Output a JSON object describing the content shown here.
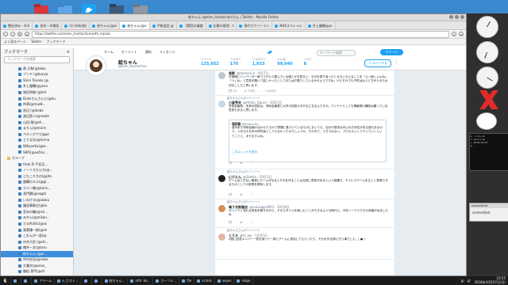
{
  "desktop": {
    "icons": [
      "folder-red-icon",
      "folder-blue-icon",
      "twitter-icon",
      "folder-dark-icon",
      "folder-gray-icon"
    ]
  },
  "browser": {
    "title": "絵ちゃん (@eien_hantachan)さん | Twitter - Mozilla Firefox",
    "tabs": [
      "整形済み - 4ch",
      "合同・市場見",
      "(1) 所有(絵)",
      "絵ちゃん(@ei",
      "絵ちゃん(@e",
      "手帳会話 @",
      "【関西の議論",
      "記事の管理 - t",
      "現代ホワイトラン",
      "NHKスペシャル",
      "井上優輔@yo"
    ],
    "active_tab_index": 4,
    "url": "https://twitter.com/eien_hantachan/with_replies",
    "bookmarks_bar": [
      "よく見るページ",
      "Twitter",
      "ブックマーク"
    ]
  },
  "sidebar": {
    "title": "ブックマーク",
    "search_placeholder": "ブックマークを検索",
    "items": [
      {
        "label": "燕 大和(@kabu",
        "folder": false
      },
      {
        "label": "ブンヤ (@bunya",
        "folder": false
      },
      {
        "label": "Shiro Tanaka (@",
        "folder": false
      },
      {
        "label": "井上優輔(@yosu",
        "folder": false
      },
      {
        "label": "和田秀樹 (@hid",
        "folder": false
      },
      {
        "label": "Dukeさんさんと(@du",
        "folder": false
      },
      {
        "label": "仲原(@maz8...",
        "folder": false
      },
      {
        "label": "池辺 (@ikebe",
        "folder": false
      },
      {
        "label": "渡辺直人(@naoto",
        "folder": false
      },
      {
        "label": "山田 翔(@sh...",
        "folder": false
      },
      {
        "label": "まりん(@marin",
        "folder": false
      },
      {
        "label": "ペキングアカ@pe",
        "folder": false
      },
      {
        "label": "とりなお(@torina",
        "folder": false
      },
      {
        "label": "Wikipedia(@w...",
        "folder": false
      },
      {
        "label": "SW5(@sw5ns...",
        "folder": false
      },
      {
        "label": "グループ",
        "folder": true
      },
      {
        "label": "hhat 声 戸田玉...",
        "folder": false
      },
      {
        "label": "ノーミスたんち(@...",
        "folder": false
      },
      {
        "label": "じたこたちの(@jita",
        "folder": false
      },
      {
        "label": "銀翼のスエ(@gi...",
        "folder": false
      },
      {
        "label": "カリン集(@karin...",
        "folder": false
      },
      {
        "label": "長門勝(@nagat",
        "folder": false
      },
      {
        "label": "いわげる(@iwaku",
        "folder": false
      },
      {
        "label": "議会事務主(@ka",
        "folder": false
      },
      {
        "label": "宮永の輪(@ish...",
        "folder": false
      },
      {
        "label": "みかん(@mikan...",
        "folder": false
      },
      {
        "label": "ガスPolitic(@as",
        "folder": false
      },
      {
        "label": "真素爆一郎(@sh",
        "folder": false
      },
      {
        "label": "これんが一部(@",
        "folder": false
      },
      {
        "label": "市井大民 (@shi...",
        "folder": false
      },
      {
        "label": "樽井一文(@taru",
        "folder": false
      },
      {
        "label": "絵ちゃん (@ei...",
        "folder": false,
        "selected": true
      },
      {
        "label": "中村光弘(@naka",
        "folder": false
      },
      {
        "label": "大瀬文(@oose_",
        "folder": false
      },
      {
        "label": "蝶松 亮門(@ch",
        "folder": false
      },
      {
        "label": "井上 亮 (@inoue",
        "folder": false
      },
      {
        "label": "ポチ(@pochi_",
        "folder": false
      },
      {
        "label": "厦奈吉里(@karo",
        "folder": false
      },
      {
        "label": "阿佐谷(@asagaya",
        "folder": false
      }
    ]
  },
  "twitter": {
    "nav": [
      "ホーム",
      "モーメント",
      "通知",
      "メッセージ"
    ],
    "search_placeholder": "キーワード検索",
    "tweet_button": "ツイート",
    "profile": {
      "name": "絵ちゃん",
      "handle": "@eien_hantachan"
    },
    "stats": [
      {
        "label": "ツイート",
        "value": "125,652"
      },
      {
        "label": "フォロー",
        "value": "170"
      },
      {
        "label": "フォロワー",
        "value": "1,033"
      },
      {
        "label": "いいね",
        "value": "99,040"
      },
      {
        "label": "リスト",
        "value": "8"
      }
    ],
    "follow_button": "フォローする",
    "tweets": [
      {
        "context": "",
        "name": "長野",
        "handle": "@tomoso_h · 8月7日",
        "body": "お被様にハンバーガー食べさせたら喜んでいる顔とかを見ると、今日を振り返ったとるもいろんなことを「えっ新しいよね」「つくね」と意見を聞いて欲しかったとしてまたはお喋りしているかのようですね。けどそれでも子供は大人とちがうのも大切なことだと思います。",
        "acts": [
          "13",
          "7.8万",
          "24,903"
        ]
      },
      {
        "context": "絵ちゃんさんがリツイート",
        "name": "小倉秀夫",
        "handle": "@Hideo_Ogura · 10月1日",
        "body": "学術会議員、未済の回答は、学術会議員と大学の回答の方が主になるんですか。アンテナとしても情報源の構成は頼っている意見もあると思います。",
        "quote": {
          "name": "増田聡",
          "handle": "@smasuda",
          "body": "遠の前で学術会議の合わせたもので書類に基づいているものにおいても、自分の提供は中心の方向性がある感もあるので、人を元々日本の研究者としてもなかったのでしょうか。その中で、うちではない、プロセスとしてやっていくということと、ありますよね。",
          "more": "このスレッドを表示"
        }
      },
      {
        "context": "絵ちゃんさんがリツイート",
        "name": "にけたん",
        "handle": "@2ketta · 10月3日",
        "body": "ゲームはできない事実にゲームがなるとそれを作ることは当然に意味があるという認識で、そういうゲームを正しく表現できるものとしての役割を期待します。"
      },
      {
        "context": "絵ちゃんさんがリツイート",
        "name": "嗚う次郎書店",
        "handle": "@LaLaagorMX3 · 10月4日",
        "body": "ゆっくりと流れる音色を聴きながら、そのスタイルを楽しむことができるような時代に、今年ノーマスクだの決議が出ましたね"
      },
      {
        "context": "絵ちゃんさんがリツイート",
        "name": "とうろ",
        "handle": "@hi_wo · 10月5日",
        "body": "4連に回答メンバー一覧を使って一斉にチームに参加してもらったら、それを作る際に行う事でした。[ ● ]"
      }
    ]
  },
  "right_panel": {
    "popup_title": "screenShot",
    "popup_text": "screenShot",
    "terminal_lines": [
      "$ ./run.sh",
      "> build ok",
      "> 2018/10/07",
      "$ _"
    ]
  },
  "taskbar": {
    "start_icon": "linux-icon",
    "items": [
      {
        "label": "",
        "icon": "bird-icon"
      },
      {
        "label": "",
        "icon": "terminal-icon"
      },
      {
        "label": "アラーム",
        "icon": "alarm-icon"
      },
      {
        "label": "e_カスト...",
        "icon": "app-icon"
      },
      {
        "label": "",
        "icon": "app-icon"
      },
      {
        "label": "",
        "icon": "app-icon"
      },
      {
        "label": "絵ちゃん...",
        "icon": "firefox-icon"
      },
      {
        "label": "xfdl- bo...",
        "icon": "app-icon"
      },
      {
        "label": "カーソル...",
        "icon": "app-icon"
      },
      {
        "label": "file",
        "icon": "app-icon"
      },
      {
        "label": "xclock",
        "icon": "clock-icon"
      },
      {
        "label": "xeyes",
        "icon": "eyes-icon"
      },
      {
        "label": "xlogo",
        "icon": "x-icon"
      }
    ],
    "tray": {
      "lang": "jp",
      "time": "23:55",
      "date": "2018年10月07日(日)"
    }
  },
  "colors": {
    "twitter_blue": "#1da1f2",
    "sidebar_select": "#3c8ddb"
  }
}
